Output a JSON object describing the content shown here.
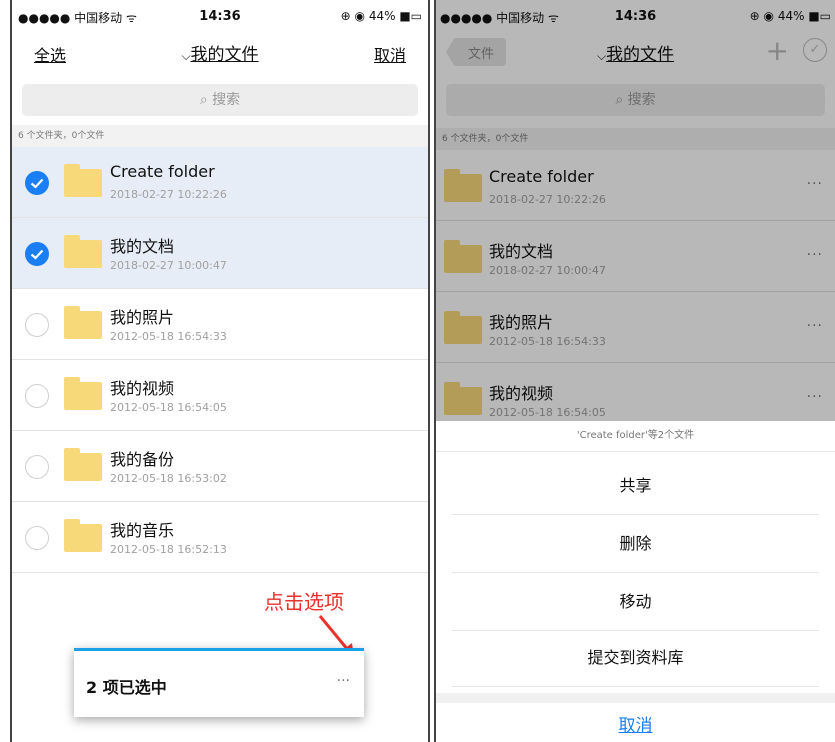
{
  "left": {
    "status": {
      "carrier": "●●●●● 中国移动 ᯤ",
      "time": "14:36",
      "battery": "⊕ ◉ 44% ■▭"
    },
    "nav": {
      "select_all": "全选",
      "title": "我的文件",
      "cancel": "取消"
    },
    "search_placeholder": "搜索",
    "count": "6 个文件夹，0个文件",
    "rows": [
      {
        "name": "Create folder",
        "date": "2018-02-27 10:22:26",
        "selected": true
      },
      {
        "name": "我的文档",
        "date": "2018-02-27 10:00:47",
        "selected": true
      },
      {
        "name": "我的照片",
        "date": "2012-05-18 16:54:33",
        "selected": false
      },
      {
        "name": "我的视频",
        "date": "2012-05-18 16:54:05",
        "selected": false
      },
      {
        "name": "我的备份",
        "date": "2012-05-18 16:53:02",
        "selected": false
      },
      {
        "name": "我的音乐",
        "date": "2012-05-18 16:52:13",
        "selected": false
      }
    ],
    "annotation": "点击选项",
    "selection_bar": {
      "label": "2 项已选中",
      "more": "···"
    }
  },
  "right": {
    "status": {
      "carrier": "●●●●● 中国移动 ᯤ",
      "time": "14:36",
      "battery": "⊕ ◉ 44% ■▭"
    },
    "nav": {
      "back": "文件",
      "title": "我的文件",
      "add": "+",
      "check": "✓"
    },
    "search_placeholder": "搜索",
    "count": "6 个文件夹，0个文件",
    "rows": [
      {
        "name": "Create folder",
        "date": "2018-02-27 10:22:26",
        "more": "···"
      },
      {
        "name": "我的文档",
        "date": "2018-02-27 10:00:47",
        "more": "···"
      },
      {
        "name": "我的照片",
        "date": "2012-05-18 16:54:33",
        "more": "···"
      },
      {
        "name": "我的视频",
        "date": "2012-05-18 16:54:05",
        "more": "···"
      }
    ],
    "sheet": {
      "title": "'Create folder'等2个文件",
      "actions": [
        "共享",
        "删除",
        "移动",
        "提交到资料库"
      ],
      "cancel": "取消"
    }
  },
  "colors": {
    "accent": "#1a7ef5",
    "folder": "#f7d97a",
    "annotation": "#e8322c",
    "selected_row": "#e7edf7"
  }
}
